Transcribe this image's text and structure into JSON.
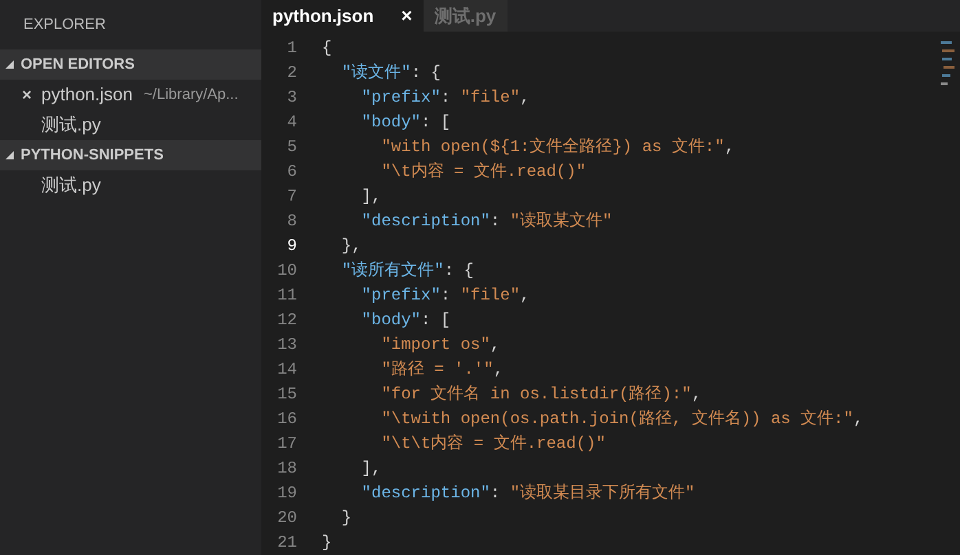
{
  "sidebar": {
    "title": "EXPLORER",
    "sections": [
      {
        "title": "OPEN EDITORS",
        "expanded": true,
        "items": [
          {
            "close": "×",
            "name": "python.json",
            "path": "~/Library/Ap..."
          },
          {
            "name": "测试.py"
          }
        ]
      },
      {
        "title": "PYTHON-SNIPPETS",
        "expanded": true,
        "items": [
          {
            "name": "测试.py"
          }
        ]
      }
    ]
  },
  "tabs": [
    {
      "label": "python.json",
      "selected": true,
      "close": "×"
    },
    {
      "label": "测试.py",
      "selected": false
    }
  ],
  "editor": {
    "lines": [
      {
        "number": "1",
        "current": false,
        "tokens": [
          {
            "kind": "punct",
            "text": "{"
          }
        ]
      },
      {
        "number": "2",
        "current": false,
        "tokens": [
          {
            "kind": "key",
            "text": "  \"读文件\""
          },
          {
            "kind": "punct",
            "text": ": {"
          }
        ]
      },
      {
        "number": "3",
        "current": false,
        "tokens": [
          {
            "kind": "key",
            "text": "    \"prefix\""
          },
          {
            "kind": "punct",
            "text": ": "
          },
          {
            "kind": "string",
            "text": "\"file\""
          },
          {
            "kind": "punct",
            "text": ","
          }
        ]
      },
      {
        "number": "4",
        "current": false,
        "tokens": [
          {
            "kind": "key",
            "text": "    \"body\""
          },
          {
            "kind": "punct",
            "text": ": ["
          }
        ]
      },
      {
        "number": "5",
        "current": false,
        "tokens": [
          {
            "kind": "string",
            "text": "      \"with open(${1:文件全路径}) as 文件:\""
          },
          {
            "kind": "punct",
            "text": ","
          }
        ]
      },
      {
        "number": "6",
        "current": false,
        "tokens": [
          {
            "kind": "string",
            "text": "      \"\\t内容 = 文件.read()\""
          }
        ]
      },
      {
        "number": "7",
        "current": false,
        "tokens": [
          {
            "kind": "punct",
            "text": "    ],"
          }
        ]
      },
      {
        "number": "8",
        "current": false,
        "tokens": [
          {
            "kind": "key",
            "text": "    \"description\""
          },
          {
            "kind": "punct",
            "text": ": "
          },
          {
            "kind": "string",
            "text": "\"读取某文件\""
          }
        ]
      },
      {
        "number": "9",
        "current": true,
        "tokens": [
          {
            "kind": "punct",
            "text": "  },"
          }
        ]
      },
      {
        "number": "10",
        "current": false,
        "tokens": [
          {
            "kind": "key",
            "text": "  \"读所有文件\""
          },
          {
            "kind": "punct",
            "text": ": {"
          }
        ]
      },
      {
        "number": "11",
        "current": false,
        "tokens": [
          {
            "kind": "key",
            "text": "    \"prefix\""
          },
          {
            "kind": "punct",
            "text": ": "
          },
          {
            "kind": "string",
            "text": "\"file\""
          },
          {
            "kind": "punct",
            "text": ","
          }
        ]
      },
      {
        "number": "12",
        "current": false,
        "tokens": [
          {
            "kind": "key",
            "text": "    \"body\""
          },
          {
            "kind": "punct",
            "text": ": ["
          }
        ]
      },
      {
        "number": "13",
        "current": false,
        "tokens": [
          {
            "kind": "string",
            "text": "      \"import os\""
          },
          {
            "kind": "punct",
            "text": ","
          }
        ]
      },
      {
        "number": "14",
        "current": false,
        "tokens": [
          {
            "kind": "string",
            "text": "      \"路径 = '.'\""
          },
          {
            "kind": "punct",
            "text": ","
          }
        ]
      },
      {
        "number": "15",
        "current": false,
        "tokens": [
          {
            "kind": "string",
            "text": "      \"for 文件名 in os.listdir(路径):\""
          },
          {
            "kind": "punct",
            "text": ","
          }
        ]
      },
      {
        "number": "16",
        "current": false,
        "tokens": [
          {
            "kind": "string",
            "text": "      \"\\twith open(os.path.join(路径, 文件名)) as 文件:\""
          },
          {
            "kind": "punct",
            "text": ","
          }
        ]
      },
      {
        "number": "17",
        "current": false,
        "tokens": [
          {
            "kind": "string",
            "text": "      \"\\t\\t内容 = 文件.read()\""
          }
        ]
      },
      {
        "number": "18",
        "current": false,
        "tokens": [
          {
            "kind": "punct",
            "text": "    ],"
          }
        ]
      },
      {
        "number": "19",
        "current": false,
        "tokens": [
          {
            "kind": "key",
            "text": "    \"description\""
          },
          {
            "kind": "punct",
            "text": ": "
          },
          {
            "kind": "string",
            "text": "\"读取某目录下所有文件\""
          }
        ]
      },
      {
        "number": "20",
        "current": false,
        "tokens": [
          {
            "kind": "punct",
            "text": "  }"
          }
        ]
      },
      {
        "number": "21",
        "current": false,
        "tokens": [
          {
            "kind": "punct",
            "text": "}"
          }
        ]
      }
    ]
  }
}
